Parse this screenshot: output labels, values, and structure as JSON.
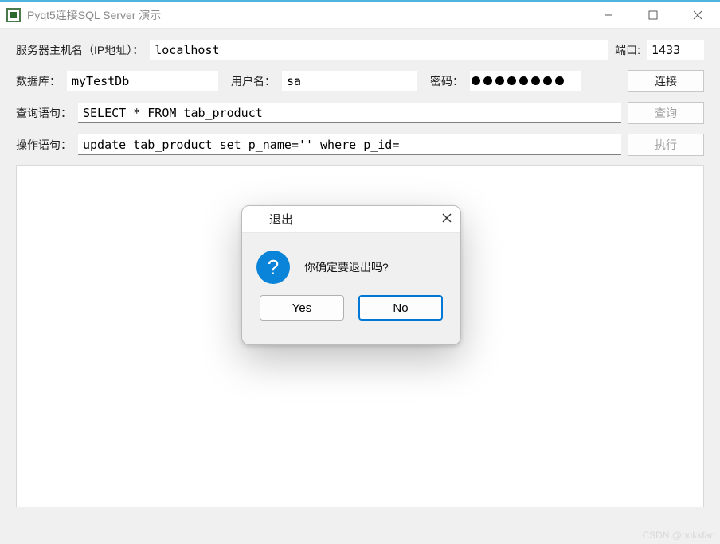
{
  "window": {
    "title": "Pyqt5连接SQL Server 演示"
  },
  "form": {
    "host_label": "服务器主机名（IP地址）：",
    "host_value": "localhost",
    "port_label": "端口:",
    "port_value": "1433",
    "db_label": "数据库：",
    "db_value": "myTestDb",
    "user_label": "用户名：",
    "user_value": "sa",
    "pwd_label": "密码：",
    "pwd_dot_count": 8,
    "connect_btn": "连接",
    "query_label": "查询语句：",
    "query_value": "SELECT * FROM tab_product",
    "query_btn": "查询",
    "exec_label": "操作语句：",
    "exec_value": "update tab_product set p_name='' where p_id=",
    "exec_btn": "执行"
  },
  "dialog": {
    "title": "退出",
    "message": "你确定要退出吗?",
    "yes": "Yes",
    "no": "No"
  },
  "watermark": "CSDN @hnkkfan"
}
